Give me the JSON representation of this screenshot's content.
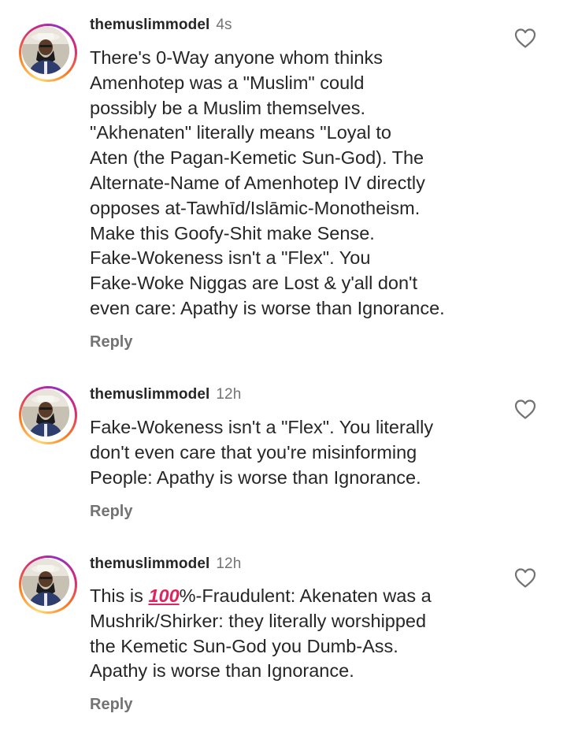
{
  "comments": [
    {
      "username": "themuslimmodel",
      "time": "4s",
      "lines": [
        "There's 0-Way anyone whom thinks",
        "Amenhotep was a \"Muslim\" could",
        "possibly be a Muslim themselves.",
        "\"Akhenaten\" literally means \"Loyal to",
        "Aten (the Pagan-Kemetic Sun-God). The",
        "Alternate-Name of Amenhotep IV directly",
        "opposes at-Tawhīd/Islāmic-Monotheism.",
        "Make this Goofy-Shit make Sense.",
        "Fake-Wokeness isn't a \"Flex\". You",
        "Fake-Woke Niggas are Lost & y'all don't",
        "even care: Apathy is worse than Ignorance."
      ],
      "reply_label": "Reply"
    },
    {
      "username": "themuslimmodel",
      "time": "12h",
      "lines": [
        "Fake-Wokeness isn't a \"Flex\". You literally",
        "don't even care that you're misinforming",
        "People: Apathy is worse than Ignorance."
      ],
      "reply_label": "Reply"
    },
    {
      "username": "themuslimmodel",
      "time": "12h",
      "first_line_prefix": "This is ",
      "emoji": "100",
      "first_line_suffix": "%-Fraudulent: Akenaten was a",
      "lines": [
        "Mushrik/Shirker: they literally worshipped",
        "the Kemetic Sun-God you Dumb-Ass.",
        "Apathy is worse than Ignorance."
      ],
      "reply_label": "Reply"
    }
  ],
  "icons": {
    "like": "heart-outline-icon",
    "emoji": "hundred-points-emoji"
  },
  "colors": {
    "text": "#262626",
    "secondary": "#737373",
    "ring_start": "#feda75",
    "ring_end": "#962fbf",
    "emoji_red": "#e0245e"
  }
}
